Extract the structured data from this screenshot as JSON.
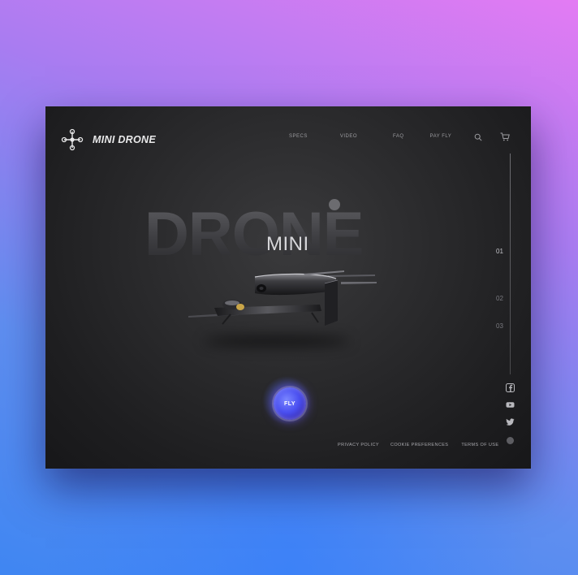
{
  "brand": {
    "name": "MINI DRONE"
  },
  "nav": {
    "items": [
      {
        "label": "SPECS"
      },
      {
        "label": "VIDEO"
      },
      {
        "label": "FAQ"
      },
      {
        "label": "PAY FLY"
      }
    ]
  },
  "hero": {
    "background_word": "DRONE",
    "title": "MINI",
    "cta_label": "FLY"
  },
  "slides": {
    "numbers": [
      "01",
      "02",
      "03"
    ],
    "active_index": 0
  },
  "social": {
    "icons": [
      "facebook-icon",
      "youtube-icon",
      "twitter-icon"
    ]
  },
  "footer": {
    "links": [
      {
        "label": "PRIVACY POLICY"
      },
      {
        "label": "COOKIE PREFERENCES"
      },
      {
        "label": "TERMS OF USE"
      }
    ]
  },
  "colors": {
    "page_gradient_top": "#e37bf3",
    "page_gradient_bottom": "#3f86f2",
    "panel": "#2b2b2d",
    "accent": "#4a4ff0"
  }
}
